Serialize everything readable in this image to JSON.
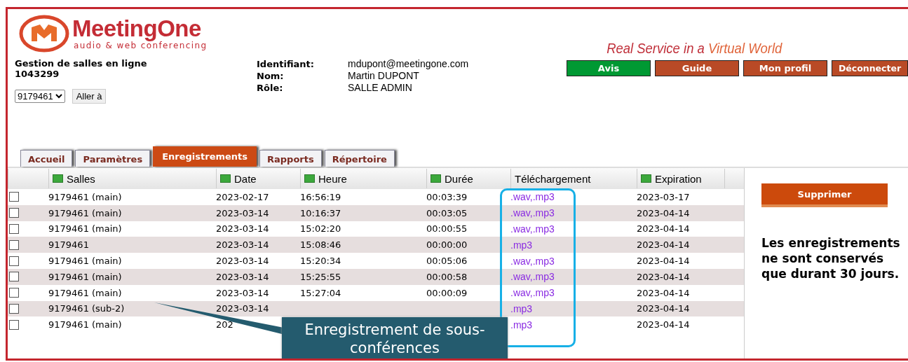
{
  "logo": {
    "name": "MeetingOne",
    "subtitle": "audio & web conferencing"
  },
  "tagline": {
    "first": "Real Service in a",
    "second": "Virtual World"
  },
  "nav_buttons": [
    {
      "label": "Avis",
      "color": "#009933"
    },
    {
      "label": "Guide",
      "color": "#b94a26"
    },
    {
      "label": "Mon profil",
      "color": "#b94a26"
    },
    {
      "label": "Déconnecter",
      "color": "#b94a26"
    }
  ],
  "account": {
    "title": "Gestion de salles en ligne",
    "number": "1043299",
    "room_select": "9179461",
    "go_button": "Aller à"
  },
  "user": [
    {
      "label": "Identifiant:",
      "value": "mdupont@meetingone.com"
    },
    {
      "label": "Nom:",
      "value": "Martin DUPONT"
    },
    {
      "label": "Rôle:",
      "value": "SALLE ADMIN"
    }
  ],
  "tabs": [
    {
      "label": "Accueil",
      "selected": false
    },
    {
      "label": "Paramètres",
      "selected": false
    },
    {
      "label": "Enregistrements",
      "selected": true
    },
    {
      "label": "Rapports",
      "selected": false
    },
    {
      "label": "Répertoire",
      "selected": false
    }
  ],
  "table": {
    "columns": [
      {
        "label": "Salles",
        "sortable": true
      },
      {
        "label": "Date",
        "sortable": true
      },
      {
        "label": "Heure",
        "sortable": true
      },
      {
        "label": "Durée",
        "sortable": true
      },
      {
        "label": "Téléchargement",
        "sortable": false
      },
      {
        "label": "Expiration",
        "sortable": true
      }
    ],
    "rows": [
      {
        "checked": false,
        "cells": [
          "9179461 (main)",
          "2023-02-17",
          "16:56:19",
          "00:03:39",
          ".wav,.mp3",
          "2023-03-17"
        ]
      },
      {
        "checked": false,
        "cells": [
          "9179461 (main)",
          "2023-03-14",
          "10:16:37",
          "00:03:05",
          ".wav,.mp3",
          "2023-04-14"
        ]
      },
      {
        "checked": false,
        "cells": [
          "9179461 (main)",
          "2023-03-14",
          "15:02:20",
          "00:00:55",
          ".wav,.mp3",
          "2023-04-14"
        ]
      },
      {
        "checked": false,
        "cells": [
          "9179461",
          "2023-03-14",
          "15:08:46",
          "00:00:00",
          ".mp3",
          "2023-04-14"
        ]
      },
      {
        "checked": false,
        "cells": [
          "9179461 (main)",
          "2023-03-14",
          "15:20:34",
          "00:05:06",
          ".wav,.mp3",
          "2023-04-14"
        ]
      },
      {
        "checked": false,
        "cells": [
          "9179461 (main)",
          "2023-03-14",
          "15:25:55",
          "00:00:58",
          ".wav,.mp3",
          "2023-04-14"
        ]
      },
      {
        "checked": false,
        "cells": [
          "9179461 (main)",
          "2023-03-14",
          "15:27:04",
          "00:00:09",
          ".wav,.mp3",
          "2023-04-14"
        ]
      },
      {
        "checked": false,
        "cells": [
          "9179461 (sub-2)",
          "2023-03-14",
          null,
          null,
          ".mp3",
          "2023-04-14"
        ]
      },
      {
        "checked": false,
        "cells": [
          "9179461 (main)",
          "202",
          null,
          null,
          ".mp3",
          "2023-04-14"
        ]
      }
    ]
  },
  "delete_button": "Supprimer",
  "notice": "Les enregistrements ne sont conservés que durant 30 jours.",
  "callout": {
    "text": "Enregistrement de sous-conférences"
  }
}
